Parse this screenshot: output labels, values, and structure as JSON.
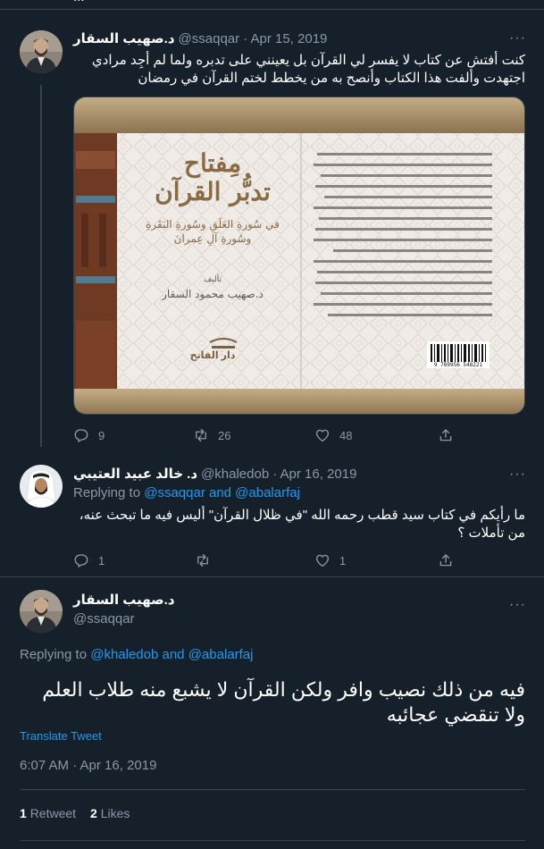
{
  "top_partial": "...",
  "tweet1": {
    "name": "د.صهيب السقار",
    "handle": "@ssaqqar",
    "date": "· Apr 15, 2019",
    "more": "···",
    "text_line1": "كنت أفتش عن كتاب لا يفسر لي القرآن بل يعينني على تدبره ولما لم أجِد مرادي",
    "text_line2": "اجتهدت وألفت هذا الكتاب وأنصح به من يخطط لختم القرآن في رمضان",
    "book": {
      "title_1": "مِفتاح",
      "title_2": "تدبُّر القرآن",
      "subtitle_1": "في سُورةِ العَلَقِ وسُورةِ البَقَرةِ",
      "subtitle_2": "وسُورةِ آلِ عِمرانَ",
      "author_label": "تأليف",
      "author": "د.صهيب محمود السقار",
      "publisher": "دار الفاتح",
      "barcode": "9 789956 548221"
    },
    "replies": "9",
    "retweets": "26",
    "likes": "48"
  },
  "tweet2": {
    "name": "د. خالد عبيد العتيبي",
    "handle": "@khaledob",
    "date": "· Apr 16, 2019",
    "more": "···",
    "replying_prefix": "Replying to",
    "replying_to": "@ssaqqar and @abalarfaj",
    "text_line1": "ما رأيكم في كتاب سيد قطب رحمه الله \"في ظلال القرآن\" أليس فيه ما تبحث عنه،",
    "text_line2": "من تأملات ؟",
    "replies": "1",
    "retweets": "",
    "likes": "1"
  },
  "main_tweet": {
    "name": "د.صهيب السقار",
    "handle": "@ssaqqar",
    "more": "···",
    "replying_prefix": "Replying to",
    "replying_to": "@khaledob and @abalarfaj",
    "text_line1": "فيه من ذلك نصيب وافر ولكن القرآن لا يشبع منه طلاب العلم",
    "text_line2": "ولا تنقضي عجائبه",
    "translate": "Translate Tweet",
    "timestamp": "6:07 AM · Apr 16, 2019",
    "retweet_count": "1",
    "retweet_label": "Retweet",
    "like_count": "2",
    "like_label": "Likes"
  },
  "colors": {
    "background": "#15202b",
    "accent": "#1d9bf0",
    "muted": "#8b98a5",
    "divider": "#38444d"
  }
}
